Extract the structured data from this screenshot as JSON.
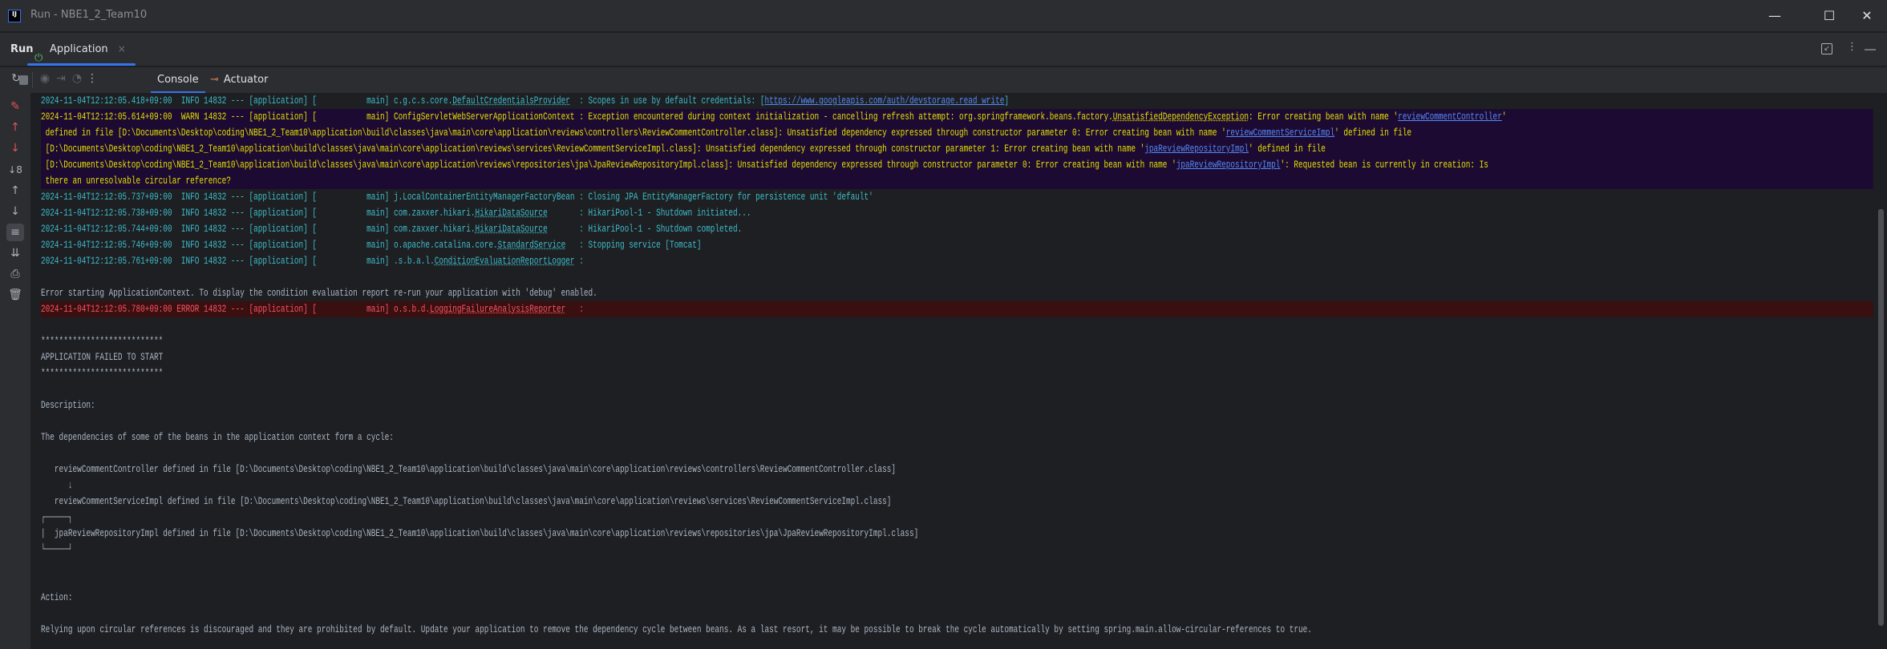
{
  "window": {
    "title": "Run - NBE1_2_Team10",
    "logo": "IJ",
    "minimize_icon": "—",
    "maximize_icon": "☐",
    "close_icon": "✕"
  },
  "run_panel": {
    "label": "Run",
    "tab": {
      "label": "Application",
      "icon": "spring-boot-icon",
      "close": "×"
    },
    "right_icons": [
      "restore-icon",
      "more-icon",
      "hide-icon"
    ]
  },
  "toolbar": {
    "buttons": [
      "rerun",
      "stop",
      "screenshot",
      "import",
      "profiler",
      "more"
    ],
    "tabs": [
      {
        "label": "Console",
        "active": true
      },
      {
        "label": "Actuator",
        "active": false
      }
    ]
  },
  "sidebar": {
    "buttons": [
      "clear",
      "previous-occurrence",
      "next-occurrence",
      "sort",
      "up",
      "down",
      "soft-wrap",
      "scroll-to-end",
      "print",
      "delete"
    ]
  },
  "colors": {
    "info": "#3dbdcc",
    "warn": "#e2e000",
    "warn_bg": "#1d0a33",
    "error": "#f75464",
    "error_bg": "#3a0f10",
    "link": "#548af7",
    "accent": "#3574f0"
  },
  "console": {
    "lines": [
      {
        "level": "info",
        "segments": [
          {
            "text": "2024-11-04T12:12:05.418+09:00  INFO 14832 --- [application] [           main] c.g.c.s.core."
          },
          {
            "text": "DefaultCredentialsProvider",
            "style": "ref"
          },
          {
            "text": "  : Scopes in use by default credentials: ["
          },
          {
            "text": "https://www.googleapis.com/auth/devstorage.read_write",
            "style": "link"
          },
          {
            "text": "]"
          }
        ]
      },
      {
        "level": "warn",
        "segments": [
          {
            "text": "2024-11-04T12:12:05.614+09:00  WARN 14832 --- [application] [           main] ConfigServletWebServerApplicationContext : Exception encountered during context initialization - cancelling refresh attempt: org.springframework.beans.factory."
          },
          {
            "text": "UnsatisfiedDependencyException",
            "style": "ref"
          },
          {
            "text": ": Error creating bean with name '"
          },
          {
            "text": "reviewCommentController",
            "style": "link"
          },
          {
            "text": "'"
          }
        ]
      },
      {
        "level": "warn",
        "segments": [
          {
            "text": " defined in file [D:\\Documents\\Desktop\\coding\\NBE1_2_Team10\\application\\build\\classes\\java\\main\\core\\application\\reviews\\controllers\\ReviewCommentController.class]: Unsatisfied dependency expressed through constructor parameter 0: Error creating bean with name '"
          },
          {
            "text": "reviewCommentServiceImpl",
            "style": "link"
          },
          {
            "text": "' defined in file"
          }
        ]
      },
      {
        "level": "warn",
        "segments": [
          {
            "text": " [D:\\Documents\\Desktop\\coding\\NBE1_2_Team10\\application\\build\\classes\\java\\main\\core\\application\\reviews\\services\\ReviewCommentServiceImpl.class]: Unsatisfied dependency expressed through constructor parameter 1: Error creating bean with name '"
          },
          {
            "text": "jpaReviewRepositoryImpl",
            "style": "link"
          },
          {
            "text": "' defined in file"
          }
        ]
      },
      {
        "level": "warn",
        "segments": [
          {
            "text": " [D:\\Documents\\Desktop\\coding\\NBE1_2_Team10\\application\\build\\classes\\java\\main\\core\\application\\reviews\\repositories\\jpa\\JpaReviewRepositoryImpl.class]: Unsatisfied dependency expressed through constructor parameter 0: Error creating bean with name '"
          },
          {
            "text": "jpaReviewRepositoryImpl",
            "style": "link"
          },
          {
            "text": "': Requested bean is currently in creation: Is"
          }
        ]
      },
      {
        "level": "warn",
        "segments": [
          {
            "text": " there an unresolvable circular reference?"
          }
        ]
      },
      {
        "level": "info",
        "segments": [
          {
            "text": "2024-11-04T12:12:05.737+09:00  INFO 14832 --- [application] [           main] j.LocalContainerEntityManagerFactoryBean : Closing JPA EntityManagerFactory for persistence unit 'default'"
          }
        ]
      },
      {
        "level": "info",
        "segments": [
          {
            "text": "2024-11-04T12:12:05.738+09:00  INFO 14832 --- [application] [           main] com.zaxxer.hikari."
          },
          {
            "text": "HikariDataSource",
            "style": "ref"
          },
          {
            "text": "       : HikariPool-1 - Shutdown initiated..."
          }
        ]
      },
      {
        "level": "info",
        "segments": [
          {
            "text": "2024-11-04T12:12:05.744+09:00  INFO 14832 --- [application] [           main] com.zaxxer.hikari."
          },
          {
            "text": "HikariDataSource",
            "style": "ref"
          },
          {
            "text": "       : HikariPool-1 - Shutdown completed."
          }
        ]
      },
      {
        "level": "info",
        "segments": [
          {
            "text": "2024-11-04T12:12:05.746+09:00  INFO 14832 --- [application] [           main] o.apache.catalina.core."
          },
          {
            "text": "StandardService",
            "style": "ref"
          },
          {
            "text": "   : Stopping service [Tomcat]"
          }
        ]
      },
      {
        "level": "info",
        "segments": [
          {
            "text": "2024-11-04T12:12:05.761+09:00  INFO 14832 --- [application] [           main] .s.b.a.l."
          },
          {
            "text": "ConditionEvaluationReportLogger",
            "style": "ref"
          },
          {
            "text": " :"
          }
        ]
      },
      {
        "level": "plain",
        "segments": [
          {
            "text": " "
          }
        ]
      },
      {
        "level": "plain",
        "segments": [
          {
            "text": "Error starting ApplicationContext. To display the condition evaluation report re-run your application with 'debug' enabled."
          }
        ]
      },
      {
        "level": "error",
        "segments": [
          {
            "text": "2024-11-04T12:12:05.780+09:00 ERROR 14832 --- [application] [           main] o.s.b.d."
          },
          {
            "text": "LoggingFailureAnalysisReporter",
            "style": "ref"
          },
          {
            "text": "   :"
          }
        ]
      },
      {
        "level": "plain",
        "segments": [
          {
            "text": " "
          }
        ]
      },
      {
        "level": "plain",
        "segments": [
          {
            "text": "***************************"
          }
        ]
      },
      {
        "level": "plain",
        "segments": [
          {
            "text": "APPLICATION FAILED TO START"
          }
        ]
      },
      {
        "level": "plain",
        "segments": [
          {
            "text": "***************************"
          }
        ]
      },
      {
        "level": "plain",
        "segments": [
          {
            "text": " "
          }
        ]
      },
      {
        "level": "plain",
        "segments": [
          {
            "text": "Description:"
          }
        ]
      },
      {
        "level": "plain",
        "segments": [
          {
            "text": " "
          }
        ]
      },
      {
        "level": "plain",
        "segments": [
          {
            "text": "The dependencies of some of the beans in the application context form a cycle:"
          }
        ]
      },
      {
        "level": "plain",
        "segments": [
          {
            "text": " "
          }
        ]
      },
      {
        "level": "plain",
        "segments": [
          {
            "text": "   reviewCommentController defined in file [D:\\Documents\\Desktop\\coding\\NBE1_2_Team10\\application\\build\\classes\\java\\main\\core\\application\\reviews\\controllers\\ReviewCommentController.class]"
          }
        ]
      },
      {
        "level": "plain",
        "segments": [
          {
            "text": "      ↓"
          }
        ]
      },
      {
        "level": "plain",
        "segments": [
          {
            "text": "   reviewCommentServiceImpl defined in file [D:\\Documents\\Desktop\\coding\\NBE1_2_Team10\\application\\build\\classes\\java\\main\\core\\application\\reviews\\services\\ReviewCommentServiceImpl.class]"
          }
        ]
      },
      {
        "level": "plain",
        "segments": [
          {
            "text": "┌─────┐"
          }
        ]
      },
      {
        "level": "plain",
        "segments": [
          {
            "text": "|  jpaReviewRepositoryImpl defined in file [D:\\Documents\\Desktop\\coding\\NBE1_2_Team10\\application\\build\\classes\\java\\main\\core\\application\\reviews\\repositories\\jpa\\JpaReviewRepositoryImpl.class]"
          }
        ]
      },
      {
        "level": "plain",
        "segments": [
          {
            "text": "└─────┘"
          }
        ]
      },
      {
        "level": "plain",
        "segments": [
          {
            "text": " "
          }
        ]
      },
      {
        "level": "plain",
        "segments": [
          {
            "text": " "
          }
        ]
      },
      {
        "level": "plain",
        "segments": [
          {
            "text": "Action:"
          }
        ]
      },
      {
        "level": "plain",
        "segments": [
          {
            "text": " "
          }
        ]
      },
      {
        "level": "plain",
        "segments": [
          {
            "text": "Relying upon circular references is discouraged and they are prohibited by default. Update your application to remove the dependency cycle between beans. As a last resort, it may be possible to break the cycle automatically by setting spring.main.allow-circular-references to true."
          }
        ]
      }
    ]
  }
}
